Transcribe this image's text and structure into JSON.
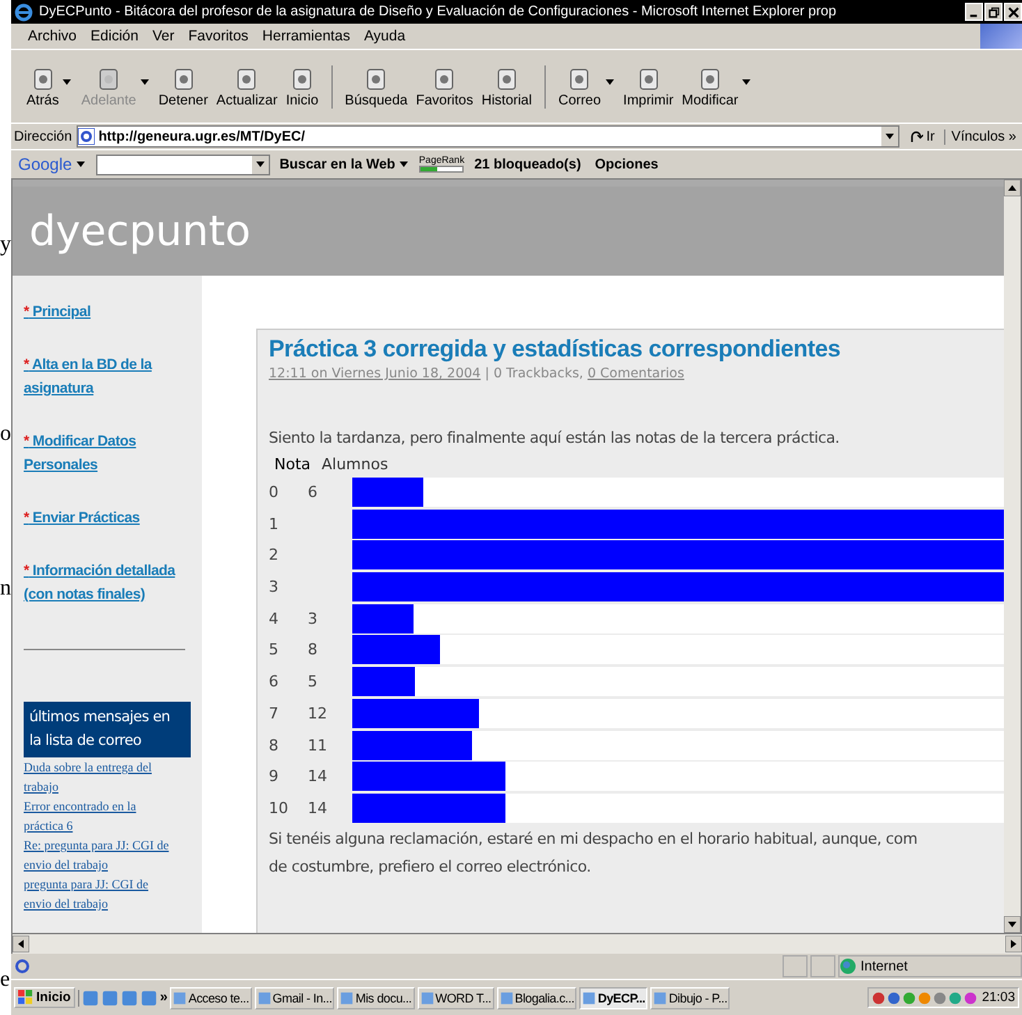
{
  "background_fragments": [
    "y",
    "o",
    "n",
    "e"
  ],
  "window": {
    "title": "DyECPunto - Bitácora del profesor de la asignatura de Diseño y Evaluación de Configuraciones - Microsoft Internet Explorer prop"
  },
  "menu": [
    "Archivo",
    "Edición",
    "Ver",
    "Favoritos",
    "Herramientas",
    "Ayuda"
  ],
  "toolbar": [
    [
      {
        "label": "Atrás",
        "disabled": false,
        "dropdown": true
      },
      {
        "label": "Adelante",
        "disabled": true,
        "dropdown": true
      },
      {
        "label": "Detener",
        "disabled": false,
        "dropdown": false
      },
      {
        "label": "Actualizar",
        "disabled": false,
        "dropdown": false
      },
      {
        "label": "Inicio",
        "disabled": false,
        "dropdown": false
      }
    ],
    [
      {
        "label": "Búsqueda",
        "disabled": false,
        "dropdown": false
      },
      {
        "label": "Favoritos",
        "disabled": false,
        "dropdown": false
      },
      {
        "label": "Historial",
        "disabled": false,
        "dropdown": false
      }
    ],
    [
      {
        "label": "Correo",
        "disabled": false,
        "dropdown": true
      },
      {
        "label": "Imprimir",
        "disabled": false,
        "dropdown": false
      },
      {
        "label": "Modificar",
        "disabled": false,
        "dropdown": true
      }
    ]
  ],
  "address": {
    "label": "Dirección",
    "url": "http://geneura.ugr.es/MT/DyEC/",
    "go": "Ir",
    "links": "Vínculos »"
  },
  "google_bar": {
    "logo": "Google",
    "search": "Buscar en la Web",
    "pagerank": "PageRank",
    "blocked": "21 bloqueado(s)",
    "options": "Opciones"
  },
  "page": {
    "site_title": "dyecpunto",
    "nav": [
      {
        "marker": "*",
        "label": "Principal"
      },
      {
        "marker": "*",
        "label": "Alta en la BD de la asignatura"
      },
      {
        "marker": "*",
        "label": "Modificar Datos Personales"
      },
      {
        "marker": "*",
        "label": "Enviar Prácticas"
      },
      {
        "marker": "*",
        "label": "Información detallada (con notas finales)"
      }
    ],
    "mail_heading": "últimos mensajes en la lista de correo",
    "mail": [
      "Duda sobre la entrega del trabajo",
      "Error encontrado en la práctica 6",
      "Re: pregunta para JJ: CGI de envio del trabajo",
      "pregunta para JJ: CGI de envio del trabajo"
    ],
    "post": {
      "title": "Práctica 3 corregida y estadísticas correspondientes",
      "date": "12:11 on Viernes Junio 18, 2004",
      "trackbacks": " | 0 Trackbacks, ",
      "comments": "0 Comentarios",
      "intro": "Siento la tardanza, pero finalmente aquí están las notas de la tercera práctica.",
      "columns": [
        "Nota",
        "Alumnos"
      ],
      "rows": [
        {
          "nota": "0",
          "alumnos": "6",
          "level": 0.11
        },
        {
          "nota": "1",
          "level": 1
        },
        {
          "nota": "2",
          "level": 1
        },
        {
          "nota": "3",
          "level": 1
        },
        {
          "nota": "4",
          "alumnos": "3",
          "level": 0.095
        },
        {
          "nota": "5",
          "alumnos": "8",
          "level": 0.134
        },
        {
          "nota": "6",
          "alumnos": "5",
          "level": 0.097
        },
        {
          "nota": "7",
          "alumnos": "12",
          "level": 0.195
        },
        {
          "nota": "8",
          "alumnos": "11",
          "level": 0.184
        },
        {
          "nota": "9",
          "alumnos": "14",
          "level": 0.234
        },
        {
          "nota": "10",
          "alumnos": "14",
          "level": 0.234
        }
      ],
      "outro": [
        "Si tenéis alguna reclamación, estaré en mi despacho en el horario habitual, aunque, com",
        "de costumbre, prefiero el correo electrónico."
      ]
    }
  },
  "status_bar": {
    "zone": "Internet"
  },
  "taskbar": {
    "start": "Inicio",
    "more": "»",
    "tasks": [
      {
        "label": "Acceso te...",
        "selected": false
      },
      {
        "label": "Gmail - In...",
        "selected": false
      },
      {
        "label": "Mis docu...",
        "selected": false
      },
      {
        "label": "WORD T...",
        "selected": false
      },
      {
        "label": "Blogalia.c...",
        "selected": false
      },
      {
        "label": "DyECP...",
        "selected": true
      },
      {
        "label": "Dibujo - P...",
        "selected": false
      }
    ],
    "clock": "21:03"
  }
}
